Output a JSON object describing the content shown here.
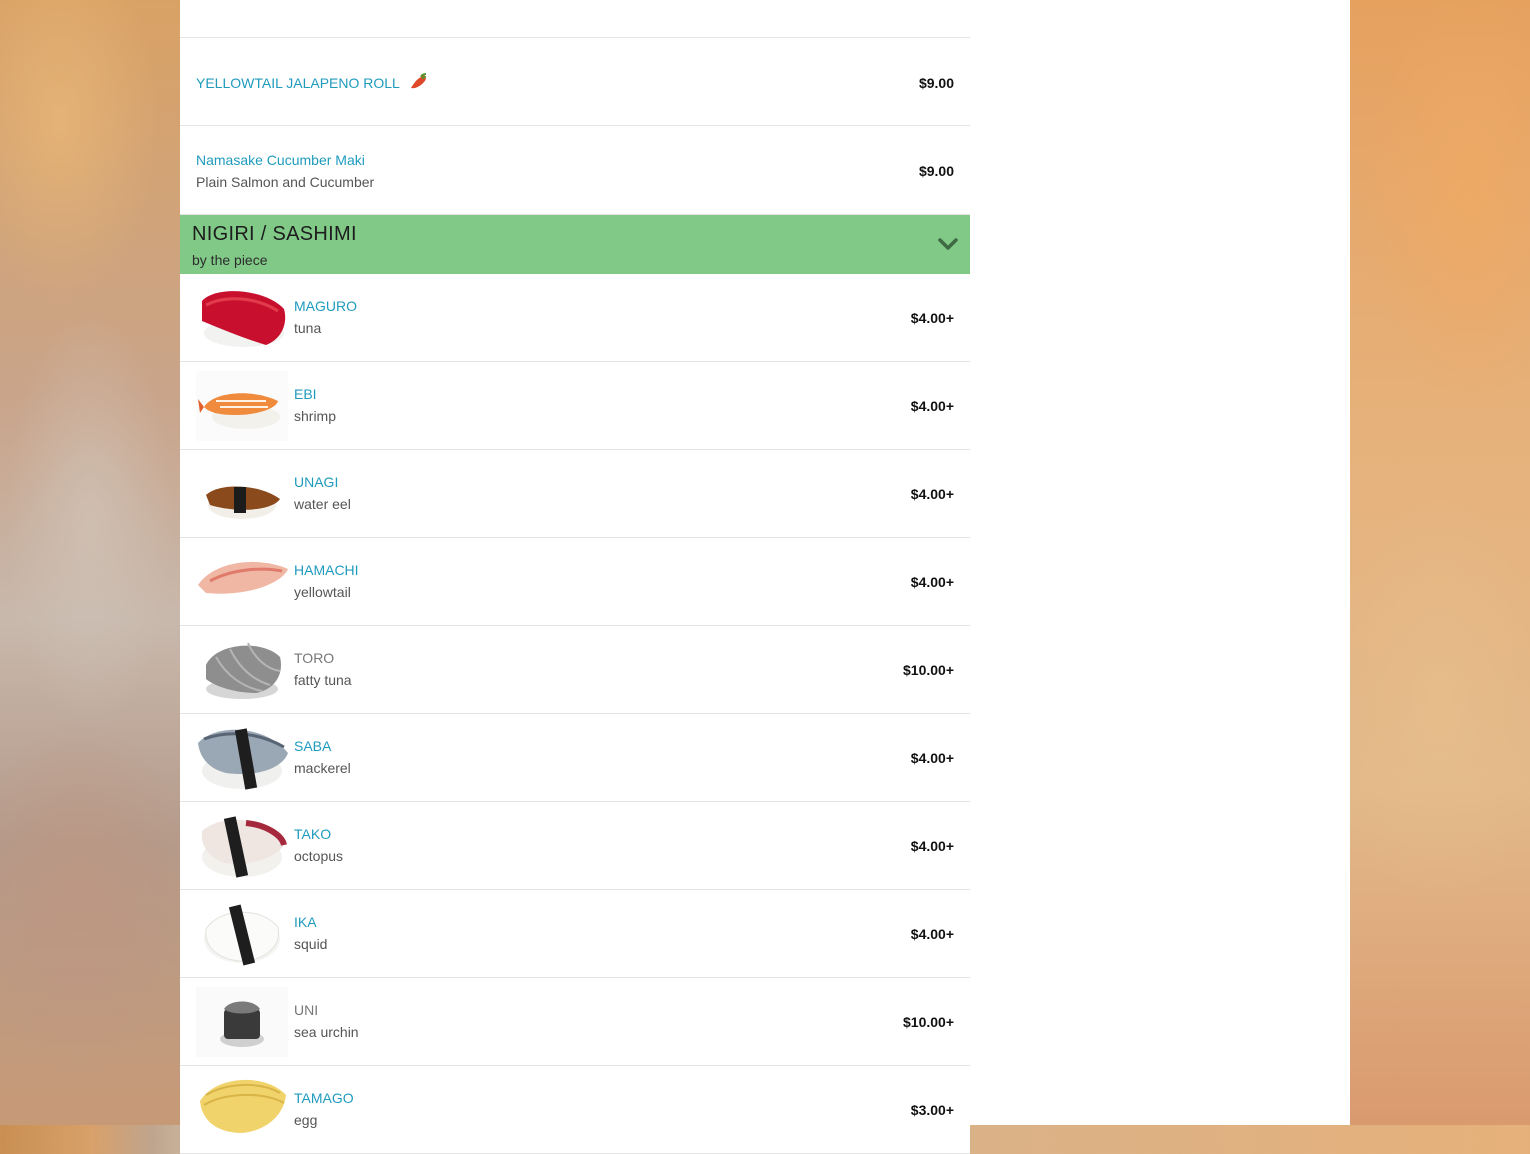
{
  "colors": {
    "accent": "#1f9bbd",
    "section_bg": "#80c986",
    "muted_name": "#777777"
  },
  "top_items": [
    {
      "name": "YELLOWTAIL JALAPENO ROLL",
      "price": "$9.00",
      "icon": "chili-pepper-icon"
    },
    {
      "name": "Namasake Cucumber Maki",
      "desc": "Plain Salmon and Cucumber",
      "price": "$9.00"
    }
  ],
  "section": {
    "title": "NIGIRI / SASHIMI",
    "subtitle": "by the piece",
    "icon": "chevron-down-icon"
  },
  "items": [
    {
      "name": "MAGURO",
      "desc": "tuna",
      "price": "$4.00+"
    },
    {
      "name": "EBI",
      "desc": "shrimp",
      "price": "$4.00+"
    },
    {
      "name": "UNAGI",
      "desc": "water eel",
      "price": "$4.00+"
    },
    {
      "name": "HAMACHI",
      "desc": "yellowtail",
      "price": "$4.00+"
    },
    {
      "name": "TORO",
      "desc": "fatty tuna",
      "price": "$10.00+"
    },
    {
      "name": "SABA",
      "desc": "mackerel",
      "price": "$4.00+"
    },
    {
      "name": "TAKO",
      "desc": "octopus",
      "price": "$4.00+"
    },
    {
      "name": "IKA",
      "desc": "squid",
      "price": "$4.00+"
    },
    {
      "name": "UNI",
      "desc": "sea urchin",
      "price": "$10.00+"
    },
    {
      "name": "TAMAGO",
      "desc": "egg",
      "price": "$3.00+"
    }
  ]
}
